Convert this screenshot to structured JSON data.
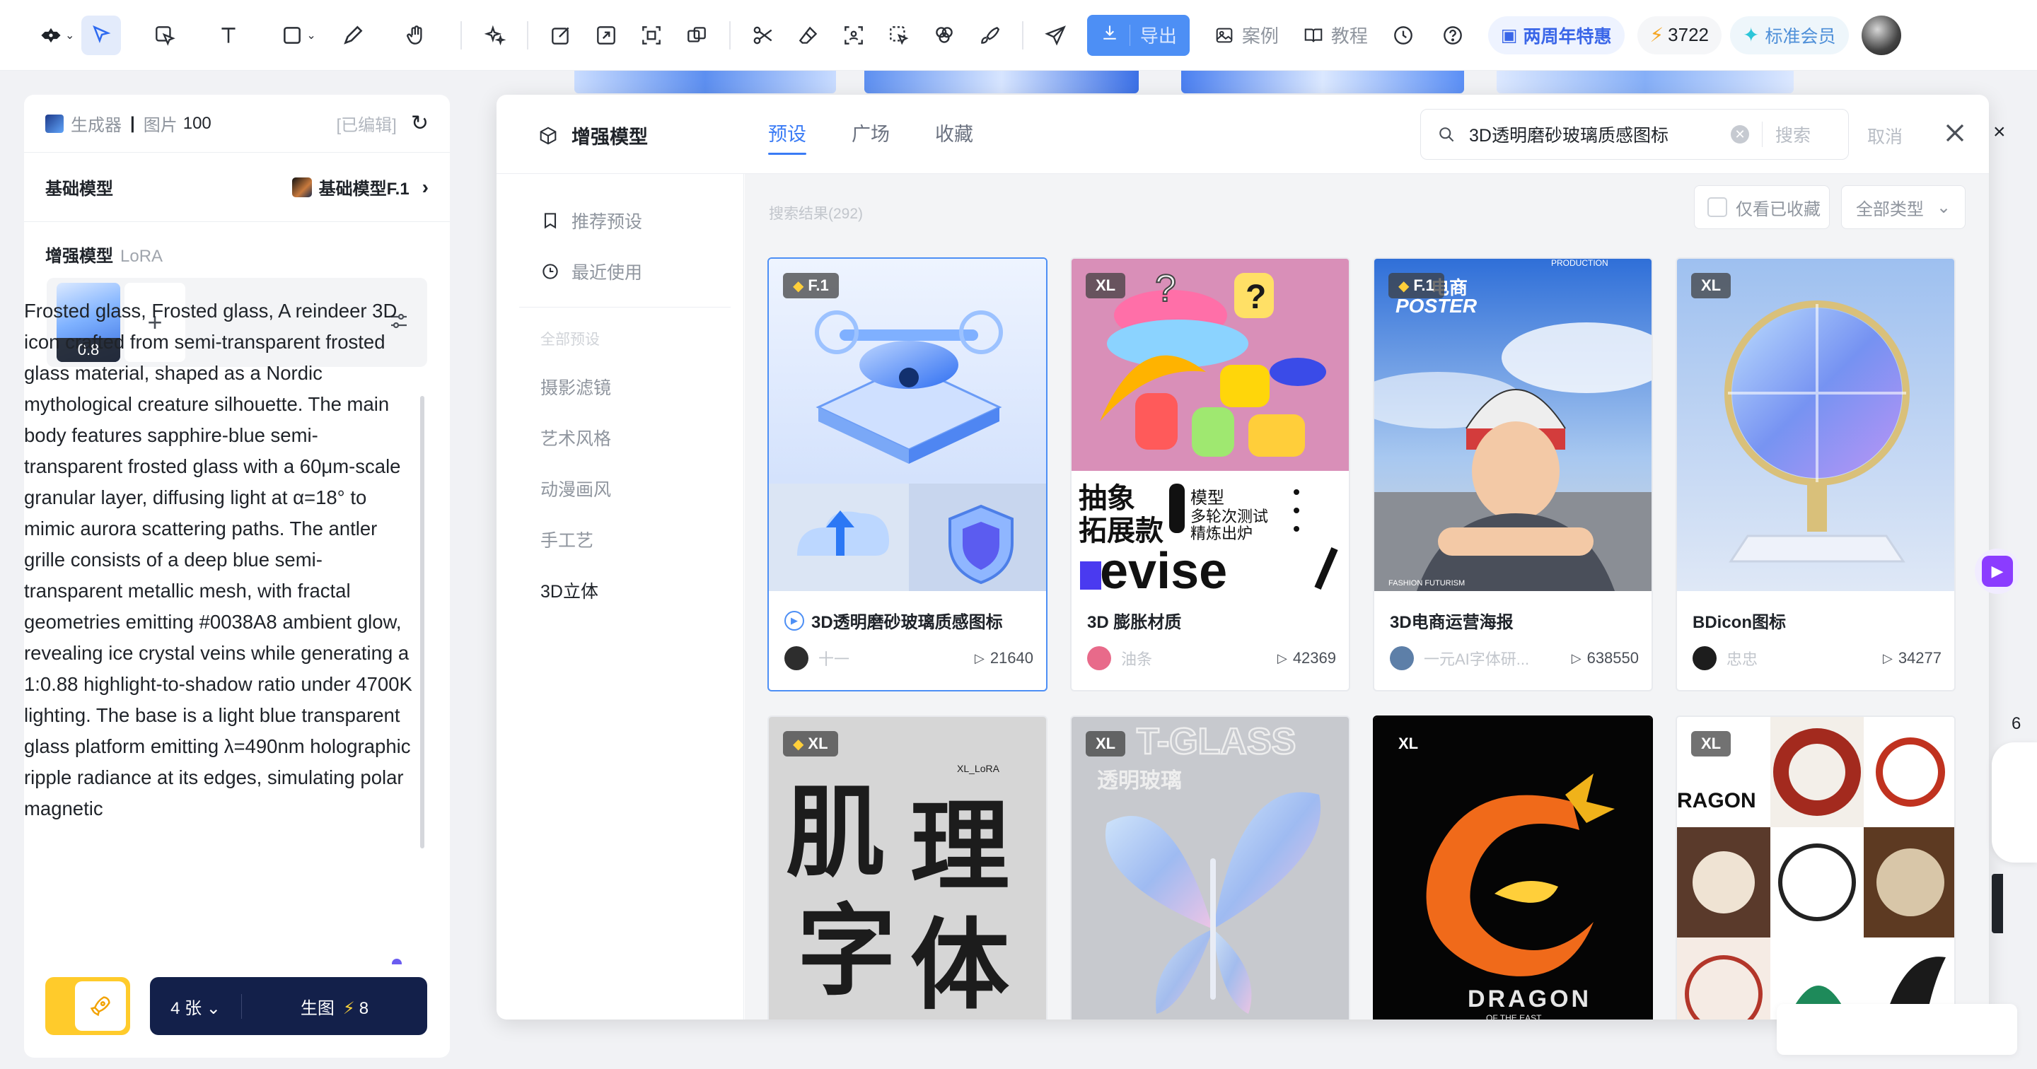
{
  "toolbar": {
    "export_label": "导出",
    "links": {
      "cases": "案例",
      "tutorial": "教程"
    },
    "promo": "两周年特惠",
    "coins": "3722",
    "member": "标准会员"
  },
  "left_panel": {
    "generator_label": "生成器",
    "image_label": "图片",
    "image_count": "100",
    "edited_label": "[已编辑]",
    "base_model_label": "基础模型",
    "base_model_value": "基础模型F.1",
    "enhance_label": "增强模型",
    "enhance_sub": "LoRA",
    "lora_weight": "0.8",
    "prompt": "Frosted glass, Frosted glass, A reindeer 3D icon crafted from semi-transparent frosted glass material, shaped as a Nordic mythological creature silhouette. The main body features sapphire-blue semi-transparent frosted glass with a 60μm-scale granular layer, diffusing light at α=18° to mimic aurora scattering paths. The antler grille consists of a deep blue semi-transparent metallic mesh, with fractal geometries emitting #0038A8 ambient glow, revealing ice crystal veins while generating a 1:0.88 highlight-to-shadow ratio under 4700K lighting. The base is a light blue transparent glass platform emitting λ=490nm holographic ripple radiance at its edges, simulating polar magnetic",
    "count_label": "4 张",
    "generate_label": "生图",
    "generate_cost": "8"
  },
  "modal": {
    "title": "增强模型",
    "tabs": [
      {
        "label": "预设",
        "active": true
      },
      {
        "label": "广场",
        "active": false
      },
      {
        "label": "收藏",
        "active": false
      }
    ],
    "search_value": "3D透明磨砂玻璃质感图标",
    "search_button": "搜索",
    "cancel": "取消",
    "sidebar": {
      "recommended": "推荐预设",
      "recent": "最近使用",
      "all_label": "全部预设",
      "categories": [
        "摄影滤镜",
        "艺术风格",
        "动漫画风",
        "手工艺",
        "3D立体"
      ]
    },
    "result_count": "搜索结果(292)",
    "favorites_only": "仅看已收藏",
    "type_filter": "全部类型",
    "cards": [
      {
        "badge": "F.1",
        "name": "3D透明磨砂玻璃质感图标",
        "author": "十一",
        "plays": "21640"
      },
      {
        "badge": "XL",
        "name": "3D 膨胀材质",
        "author": "油条",
        "plays": "42369"
      },
      {
        "badge": "F.1",
        "name": "3D电商运营海报",
        "author": "一元AI字体研...",
        "plays": "638550"
      },
      {
        "badge": "XL",
        "name": "BDicon图标",
        "author": "忠忠",
        "plays": "34277"
      },
      {
        "badge": "XL"
      },
      {
        "badge": "XL"
      },
      {
        "badge": "XL"
      },
      {
        "badge": "XL"
      }
    ],
    "card_texts": {
      "inflate_cn_1": "抽象",
      "inflate_cn_2": "拓展款",
      "inflate_cn_3": "模型",
      "inflate_cn_4": "多轮次测试",
      "inflate_cn_5": "精炼出炉",
      "inflate_en": "evise",
      "poster_title": "POSTER",
      "poster_cn": "电商",
      "poster_top": "PRODUCTION",
      "poster_foot": "FASHION FUTURISM",
      "font_tag": "XL_LoRA",
      "font_chars": [
        "肌",
        "理",
        "字",
        "体"
      ],
      "tglass": "T-GLASS",
      "tglass_cn": "透明玻璃",
      "dragon": "DRAGON",
      "dragon_sub": "OF THE EAST",
      "dragon_grid": "RAGON"
    }
  },
  "right_edge": {
    "number": "6"
  }
}
